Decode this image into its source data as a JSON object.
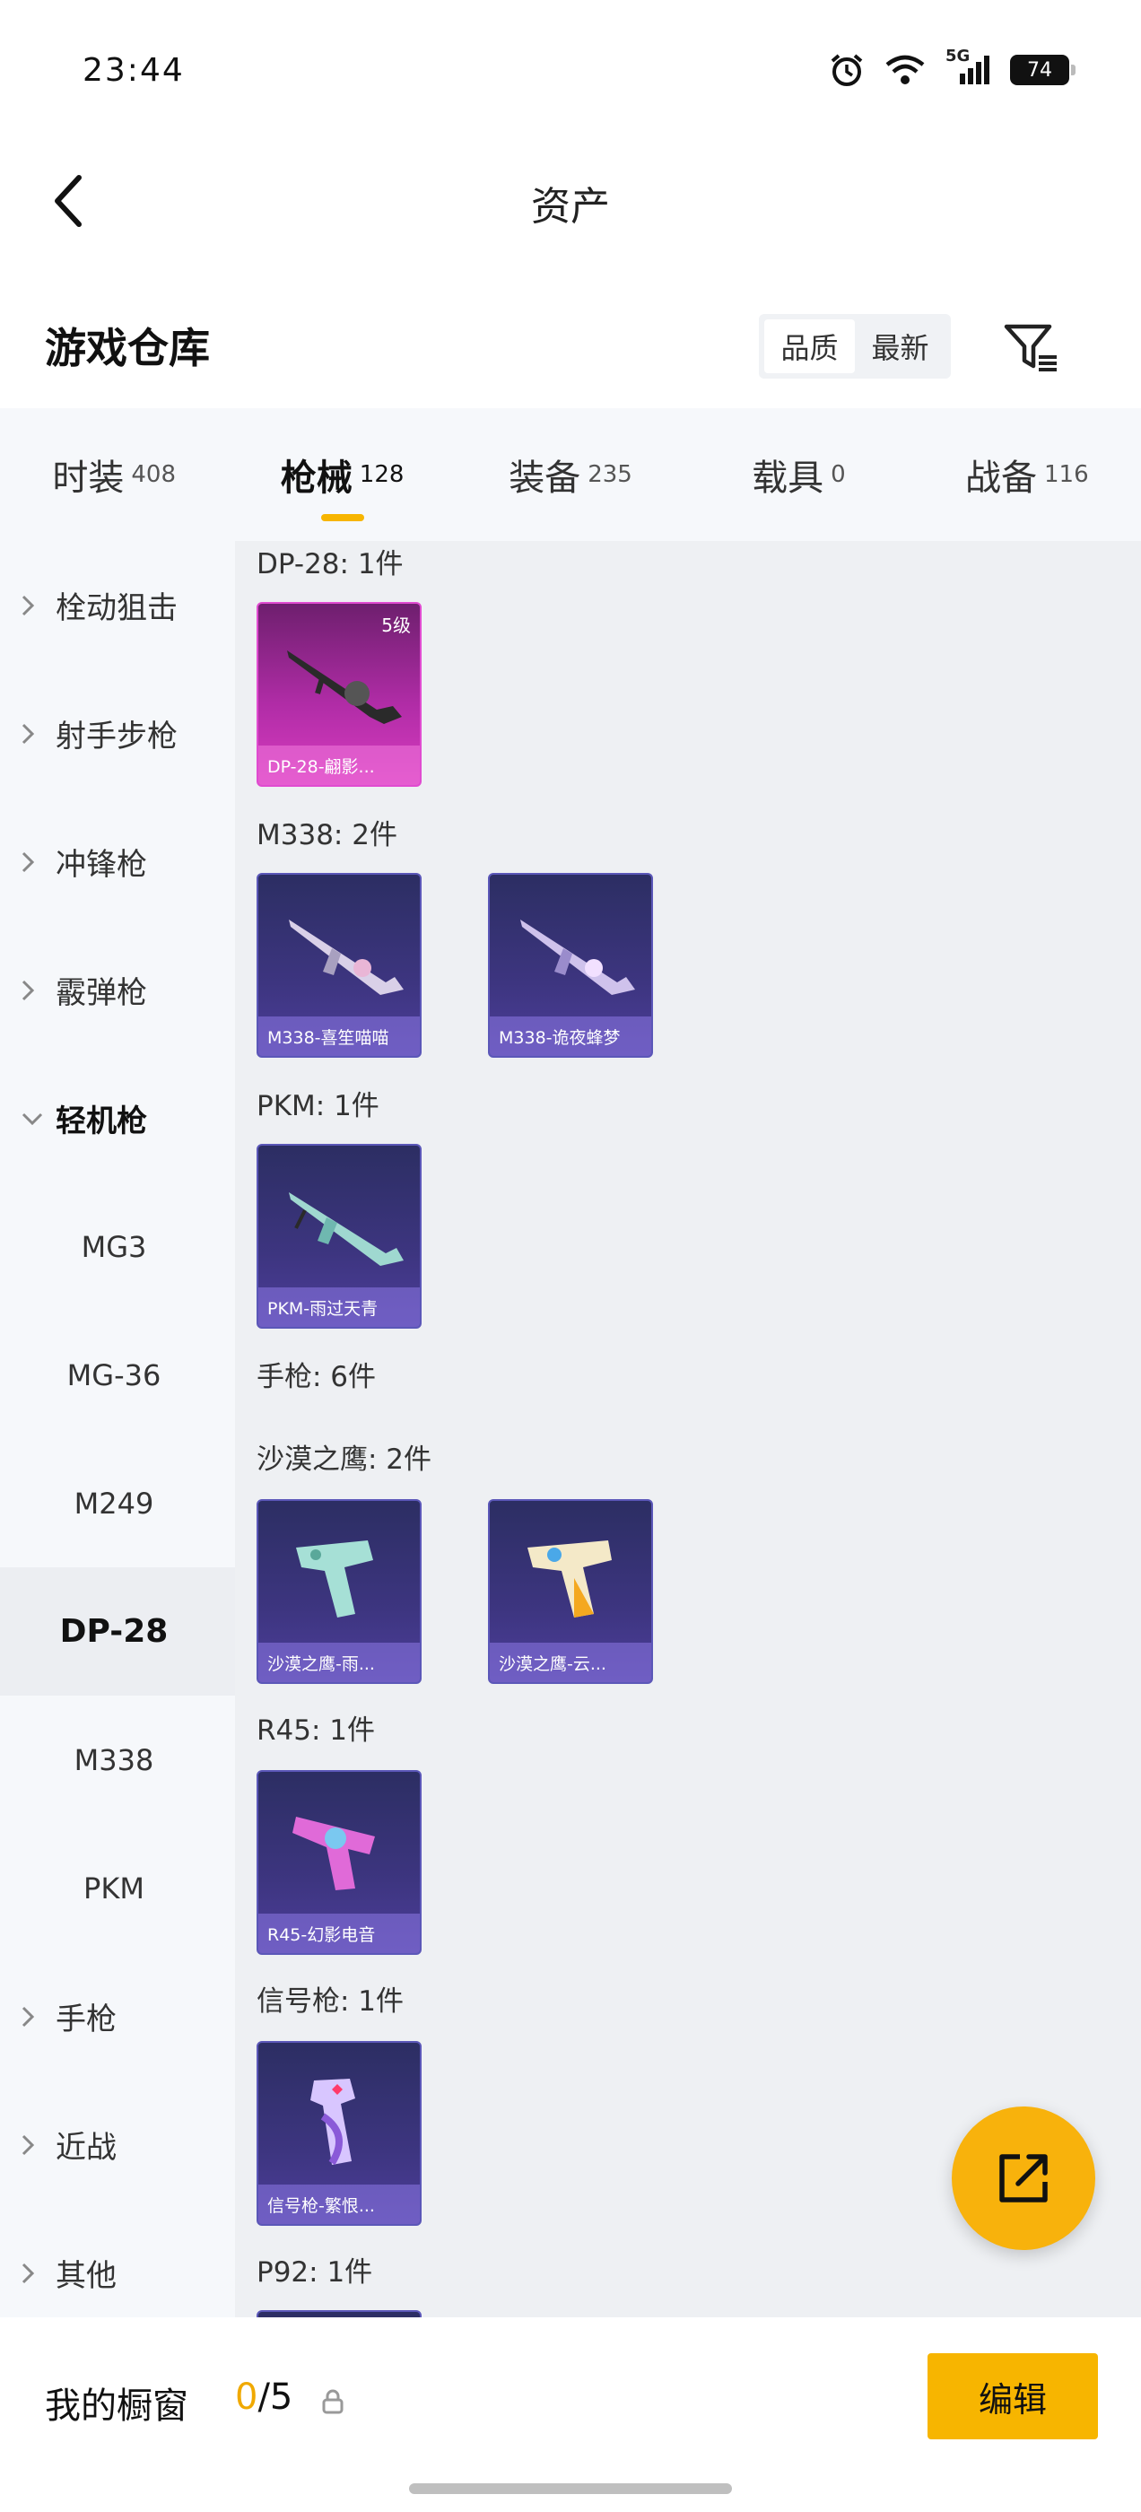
{
  "status_bar": {
    "time": "23:44",
    "network": "5G",
    "battery": "74"
  },
  "header": {
    "title": "资产"
  },
  "warehouse": {
    "title": "游戏仓库",
    "sort_options": [
      "品质",
      "最新"
    ],
    "active_sort": "品质"
  },
  "tabs": [
    {
      "label": "时装",
      "count": "408"
    },
    {
      "label": "枪械",
      "count": "128",
      "active": true
    },
    {
      "label": "装备",
      "count": "235"
    },
    {
      "label": "载具",
      "count": "0"
    },
    {
      "label": "战备",
      "count": "116"
    }
  ],
  "sidebar": {
    "items": [
      {
        "label": "栓动狙击"
      },
      {
        "label": "射手步枪"
      },
      {
        "label": "冲锋枪"
      },
      {
        "label": "霰弹枪"
      },
      {
        "label": "轻机枪"
      },
      {
        "label": "MG3"
      },
      {
        "label": "MG-36"
      },
      {
        "label": "M249"
      },
      {
        "label": "DP-28"
      },
      {
        "label": "M338"
      },
      {
        "label": "PKM"
      },
      {
        "label": "手枪"
      },
      {
        "label": "近战"
      },
      {
        "label": "其他"
      }
    ]
  },
  "content": {
    "dp28_group": "DP-28: 1件",
    "dp28_card": {
      "caption": "DP-28-翩影...",
      "level": "5级"
    },
    "m338_group": "M338: 2件",
    "m338_cards": [
      "M338-喜笙喵喵",
      "M338-诡夜蜂梦"
    ],
    "pkm_group": "PKM: 1件",
    "pkm_card": "PKM-雨过天青",
    "pistol_group": "手枪: 6件",
    "deagle_group": "沙漠之鹰: 2件",
    "deagle_cards": [
      "沙漠之鹰-雨...",
      "沙漠之鹰-云..."
    ],
    "r45_group": "R45: 1件",
    "r45_card": "R45-幻影电音",
    "flare_group": "信号枪: 1件",
    "flare_card": "信号枪-繁恨...",
    "p92_group": "P92: 1件"
  },
  "bottom_bar": {
    "showcase_label": "我的橱窗",
    "showcase_current": "0",
    "showcase_total": "/5",
    "edit_label": "编辑"
  },
  "colors": {
    "accent": "#f7b500",
    "sidebar_bg": "#f6f8fb",
    "content_bg": "#eef0f3",
    "card_purple": "#3d3580",
    "card_pink": "#c532b3"
  }
}
